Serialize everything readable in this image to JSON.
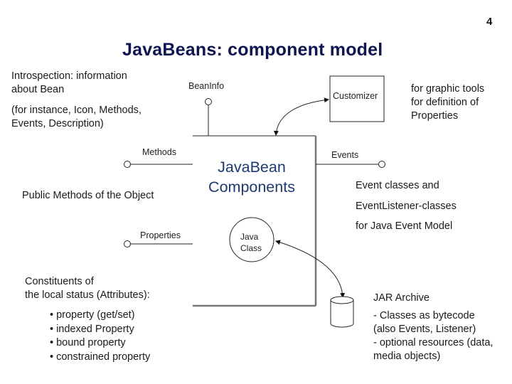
{
  "slide": {
    "page_number": "4",
    "title": "JavaBeans: component model"
  },
  "left": {
    "introspection_line1": "Introspection: information",
    "introspection_line2": "about Bean",
    "instance_line1": "(for instance, Icon, Methods,",
    "instance_line2": "Events, Description)",
    "public_methods": "Public Methods of the Object",
    "constituents_line1": "Constituents of",
    "constituents_line2": "the local status (Attributes):",
    "attributes": [
      "property (get/set)",
      "indexed Property",
      "bound property",
      "constrained property"
    ]
  },
  "diagram": {
    "beaninfo_label": "BeanInfo",
    "customizer_label": "Customizer",
    "methods_label": "Methods",
    "events_label": "Events",
    "properties_label": "Properties",
    "component_line1": "JavaBean",
    "component_line2": "Components",
    "java_class_line1": "Java",
    "java_class_line2": "Class",
    "accent_color": "#1e3a6e",
    "title_color": "#0d1550"
  },
  "right": {
    "graphic_tools_line1": "for graphic tools",
    "graphic_tools_line2": "for definition of",
    "graphic_tools_line3": "Properties",
    "event_line1": "Event classes and",
    "event_line2": "EventListener-classes",
    "event_line3": "for Java Event Model",
    "jar_title": "JAR Archive",
    "jar_line1": "- Classes as bytecode",
    "jar_line2": "(also Events, Listener)",
    "jar_line3": "- optional resources (data,",
    "jar_line4": "media objects)"
  }
}
